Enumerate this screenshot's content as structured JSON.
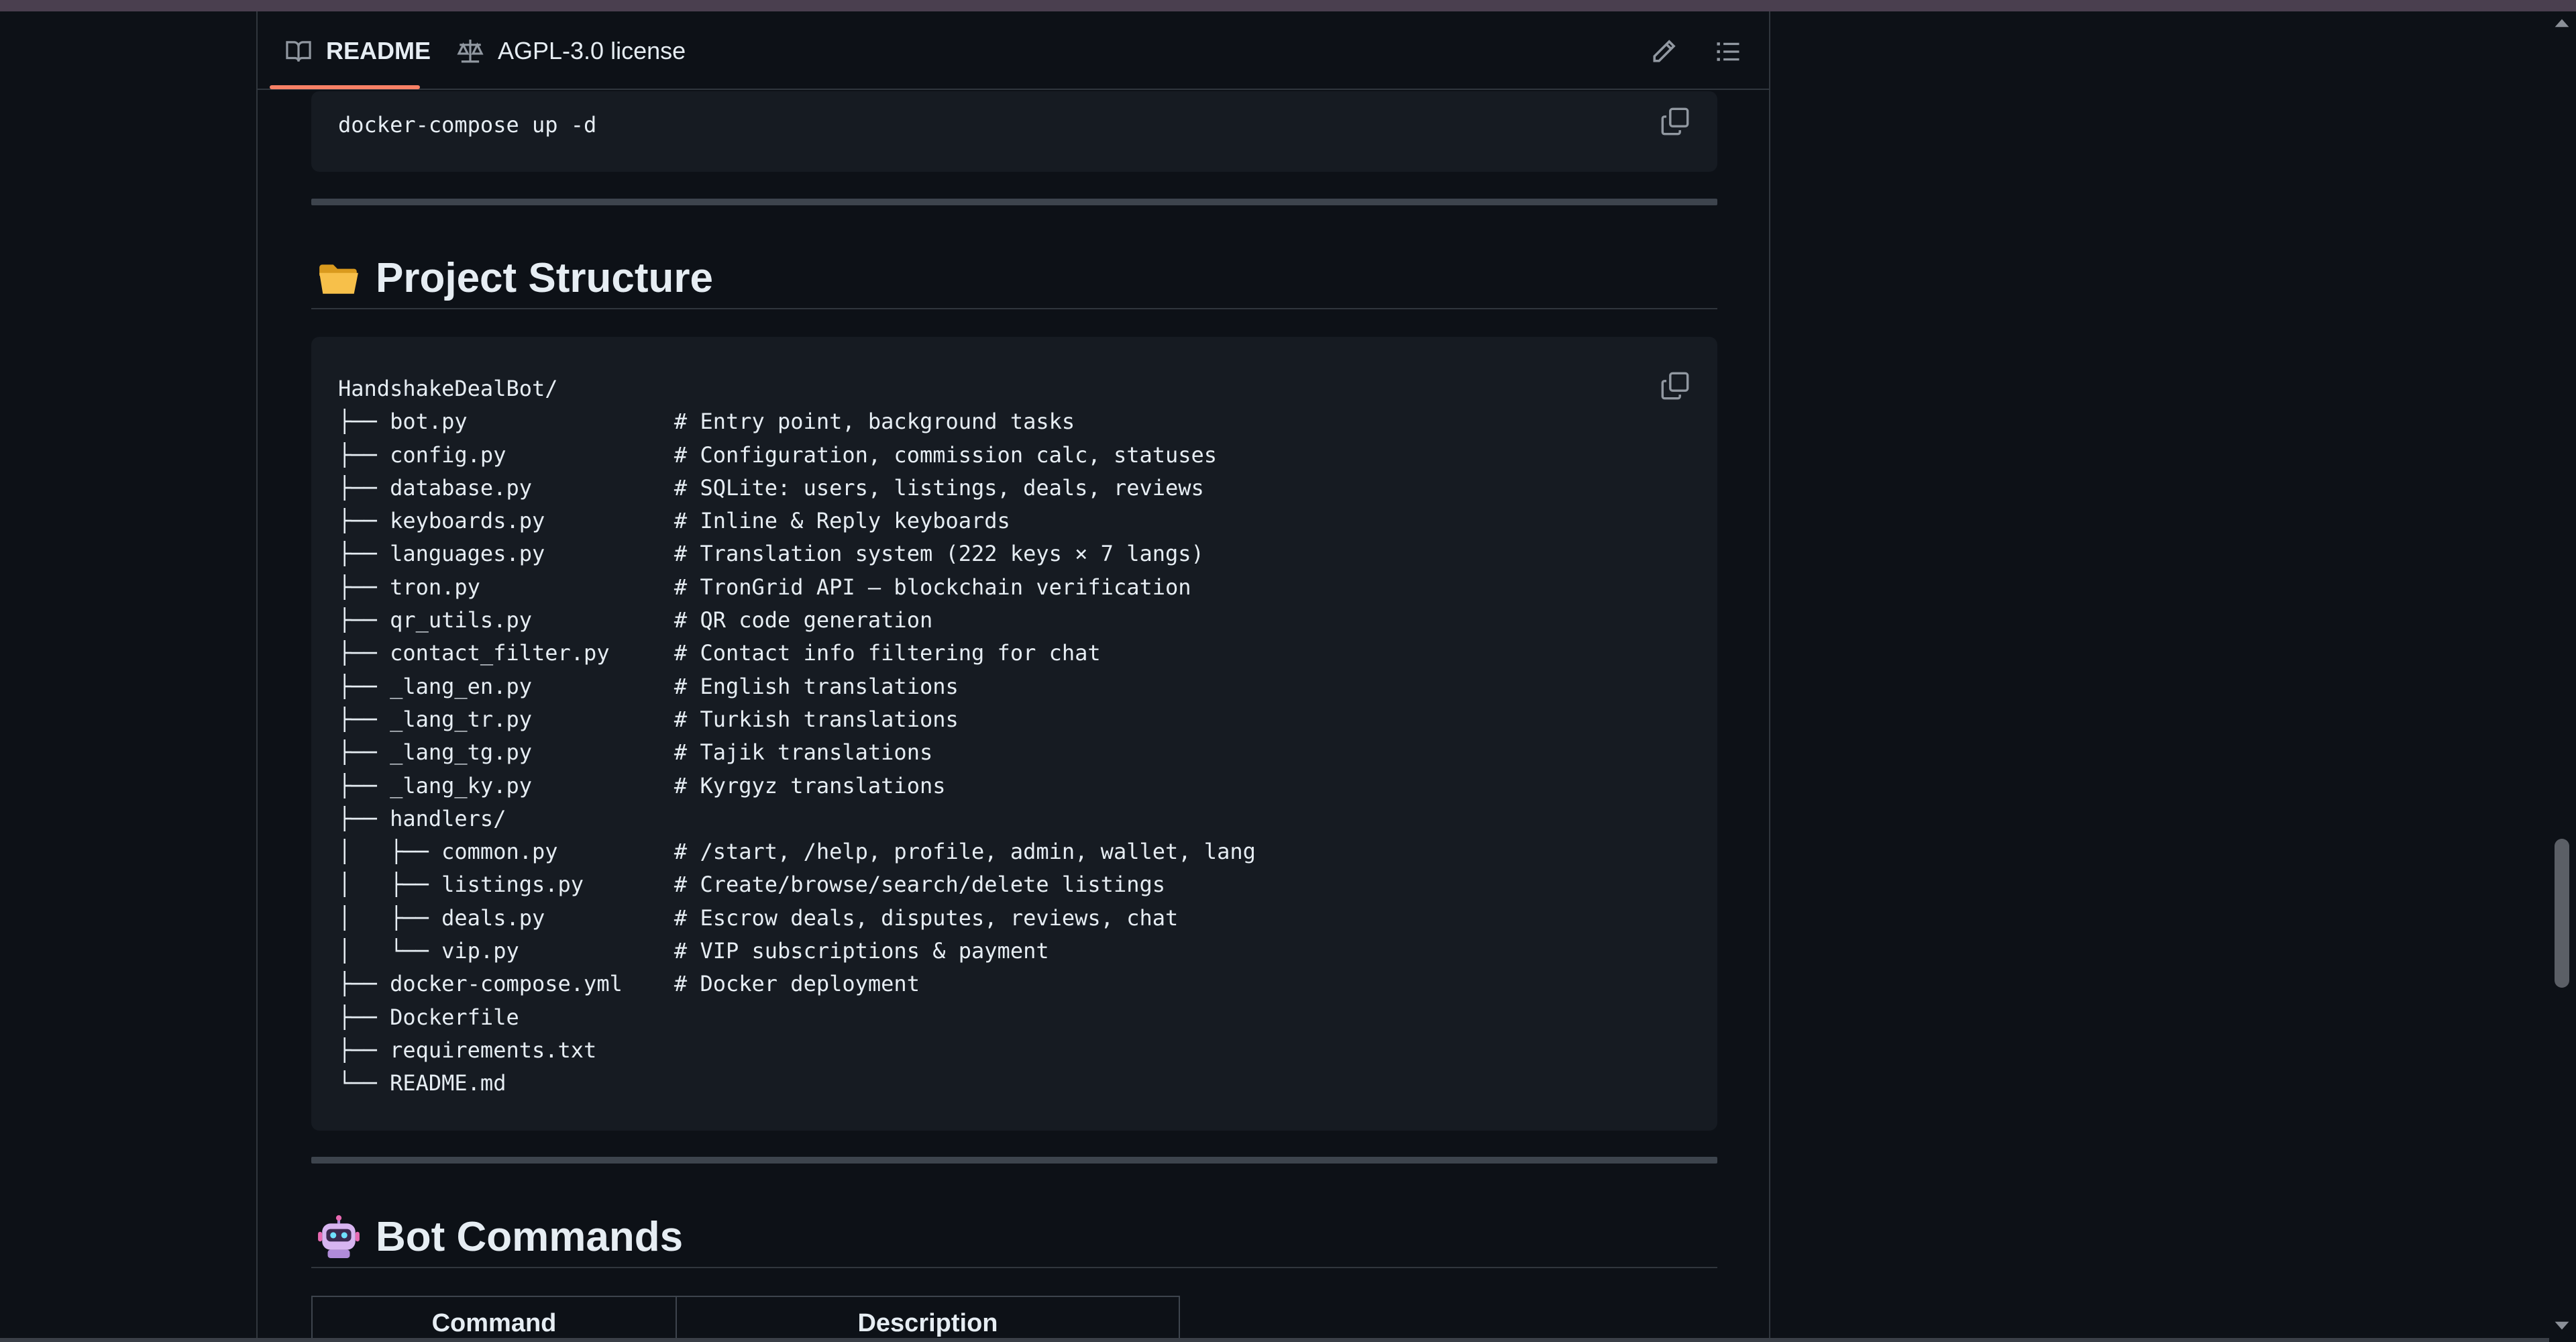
{
  "tabs": [
    {
      "label": "README",
      "icon": "book-icon",
      "active": true
    },
    {
      "label": "AGPL-3.0 license",
      "icon": "scale-icon",
      "active": false
    }
  ],
  "toolbar": {
    "edit_icon": "pencil-icon",
    "outline_icon": "list-icon"
  },
  "code_top": {
    "text": "docker-compose up -d"
  },
  "sections": {
    "project_structure": {
      "title": "Project Structure",
      "emoji": "open-folder-icon"
    },
    "bot_commands": {
      "title": "Bot Commands",
      "emoji": "robot-icon"
    }
  },
  "structure_lines": [
    "HandshakeDealBot/",
    "├── bot.py                # Entry point, background tasks",
    "├── config.py             # Configuration, commission calc, statuses",
    "├── database.py           # SQLite: users, listings, deals, reviews",
    "├── keyboards.py          # Inline & Reply keyboards",
    "├── languages.py          # Translation system (222 keys × 7 langs)",
    "├── tron.py               # TronGrid API — blockchain verification",
    "├── qr_utils.py           # QR code generation",
    "├── contact_filter.py     # Contact info filtering for chat",
    "├── _lang_en.py           # English translations",
    "├── _lang_tr.py           # Turkish translations",
    "├── _lang_tg.py           # Tajik translations",
    "├── _lang_ky.py           # Kyrgyz translations",
    "├── handlers/",
    "│   ├── common.py         # /start, /help, profile, admin, wallet, lang",
    "│   ├── listings.py       # Create/browse/search/delete listings",
    "│   ├── deals.py          # Escrow deals, disputes, reviews, chat",
    "│   └── vip.py            # VIP subscriptions & payment",
    "├── docker-compose.yml    # Docker deployment",
    "├── Dockerfile",
    "├── requirements.txt",
    "└── README.md"
  ],
  "table": {
    "headers": [
      "Command",
      "Description"
    ]
  }
}
